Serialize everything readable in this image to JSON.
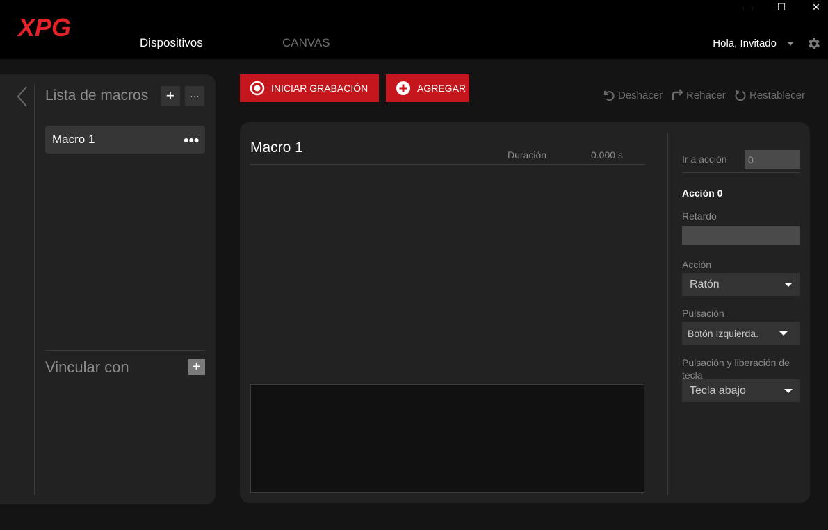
{
  "window": {
    "minimize": "—",
    "maximize": "☐",
    "close": "✕"
  },
  "header": {
    "logo": "XPG",
    "tabs": [
      "Dispositivos",
      "CANVAS"
    ],
    "user": "Hola, Invitado"
  },
  "left": {
    "title": "Lista de macros",
    "add": "+",
    "more": "···",
    "items": [
      {
        "label": "Macro 1",
        "dots": "●●●"
      }
    ],
    "link_title": "Vincular con",
    "link_add": "+"
  },
  "toolbar": {
    "record": "INICIAR GRABACIÓN",
    "add": "AGREGAR",
    "undo": "Deshacer",
    "redo": "Rehacer",
    "reset": "Restablecer"
  },
  "editor": {
    "title": "Macro 1",
    "duration_label": "Duración",
    "duration_value": "0.000 s"
  },
  "props": {
    "goto_label": "Ir a acción",
    "goto_value": "0",
    "action_heading": "Acción 0",
    "delay_label": "Retardo",
    "action_label": "Acción",
    "action_value": "Ratón",
    "press_label": "Pulsación",
    "press_value": "Botón Izquierda.",
    "press_release_label": "Pulsación y liberación de tecla",
    "press_release_value": "Tecla abajo"
  },
  "colors": {
    "accent": "#c4161c",
    "background": "#141414",
    "panel": "#222222"
  }
}
